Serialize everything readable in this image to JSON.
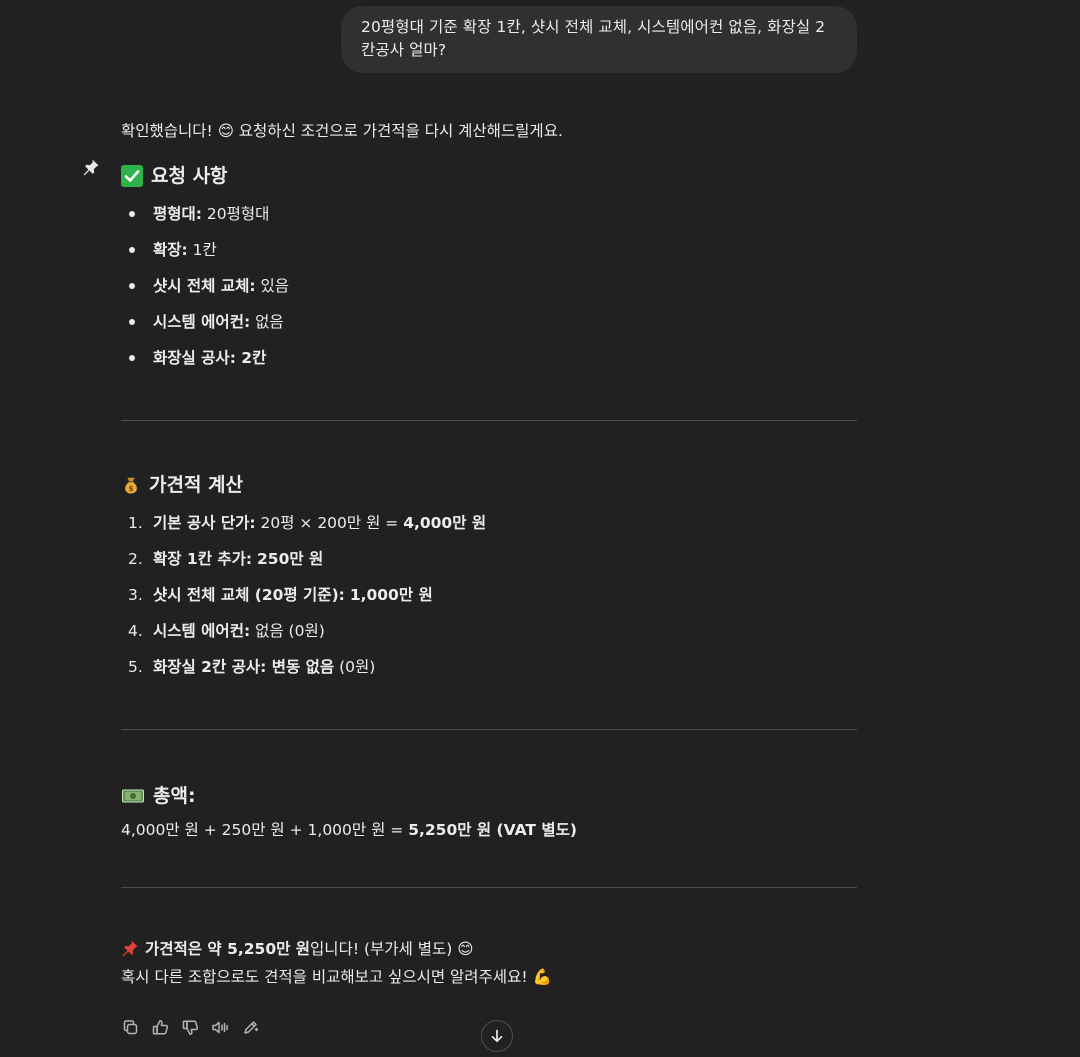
{
  "user_message": "20평형대 기준 확장 1칸, 샷시 전체 교체, 시스템에어컨 없음, 화장실 2칸공사 얼마?",
  "intro": "확인했습니다! 😊 요청하신 조건으로 가견적을 다시 계산해드릴게요.",
  "requirements": {
    "heading": "요청 사항",
    "items": [
      {
        "label": "평형대:",
        "value": " 20평형대"
      },
      {
        "label": "확장:",
        "value": " 1칸"
      },
      {
        "label": "샷시 전체 교체:",
        "value": " 있음"
      },
      {
        "label": "시스템 에어컨:",
        "value": " 없음"
      },
      {
        "label": "화장실 공사:",
        "value": " 2칸"
      }
    ]
  },
  "estimate": {
    "heading": "가견적 계산",
    "items": [
      {
        "num": "1.",
        "label": "기본 공사 단가:",
        "value": " 20평 × 200만 원 = ",
        "strong": "4,000만 원"
      },
      {
        "num": "2.",
        "label": "확장 1칸 추가:",
        "value": " ",
        "strong": "250만 원"
      },
      {
        "num": "3.",
        "label": "샷시 전체 교체 (20평 기준):",
        "value": " ",
        "strong": "1,000만 원"
      },
      {
        "num": "4.",
        "label": "시스템 에어컨:",
        "value": " 없음 (0원)",
        "strong": ""
      },
      {
        "num": "5.",
        "label": "화장실 2칸 공사:",
        "value": " 변동 없음",
        "strong": "",
        "tail": " (0원)"
      }
    ]
  },
  "total": {
    "heading": "총액:",
    "line_prefix": "4,000만 원 + 250만 원 + 1,000만 원 = ",
    "line_strong": "5,250만 원 (VAT 별도)"
  },
  "closing": {
    "line1_bold": "가견적은 약 5,250만 원",
    "line1_rest": "입니다! (부가세 별도) 😊",
    "line2": "혹시 다른 조합으로도 견적을 비교해보고 싶으시면 알려주세요! 💪"
  },
  "icons": {
    "pin": "pushpin-icon",
    "check": "check-mark-icon",
    "money_bag": "money-bag-icon",
    "banknote": "banknote-icon",
    "copy": "copy-icon",
    "thumbs_up": "thumbs-up-icon",
    "thumbs_down": "thumbs-down-icon",
    "read_aloud": "speaker-icon",
    "edit": "edit-icon",
    "scroll_down": "arrow-down-icon"
  },
  "colors": {
    "background": "#212121",
    "bubble": "#303030",
    "text": "#ececec",
    "divider": "#4a4a4a",
    "check_green": "#2fb24c",
    "icon_gray": "#b4b4b4"
  }
}
